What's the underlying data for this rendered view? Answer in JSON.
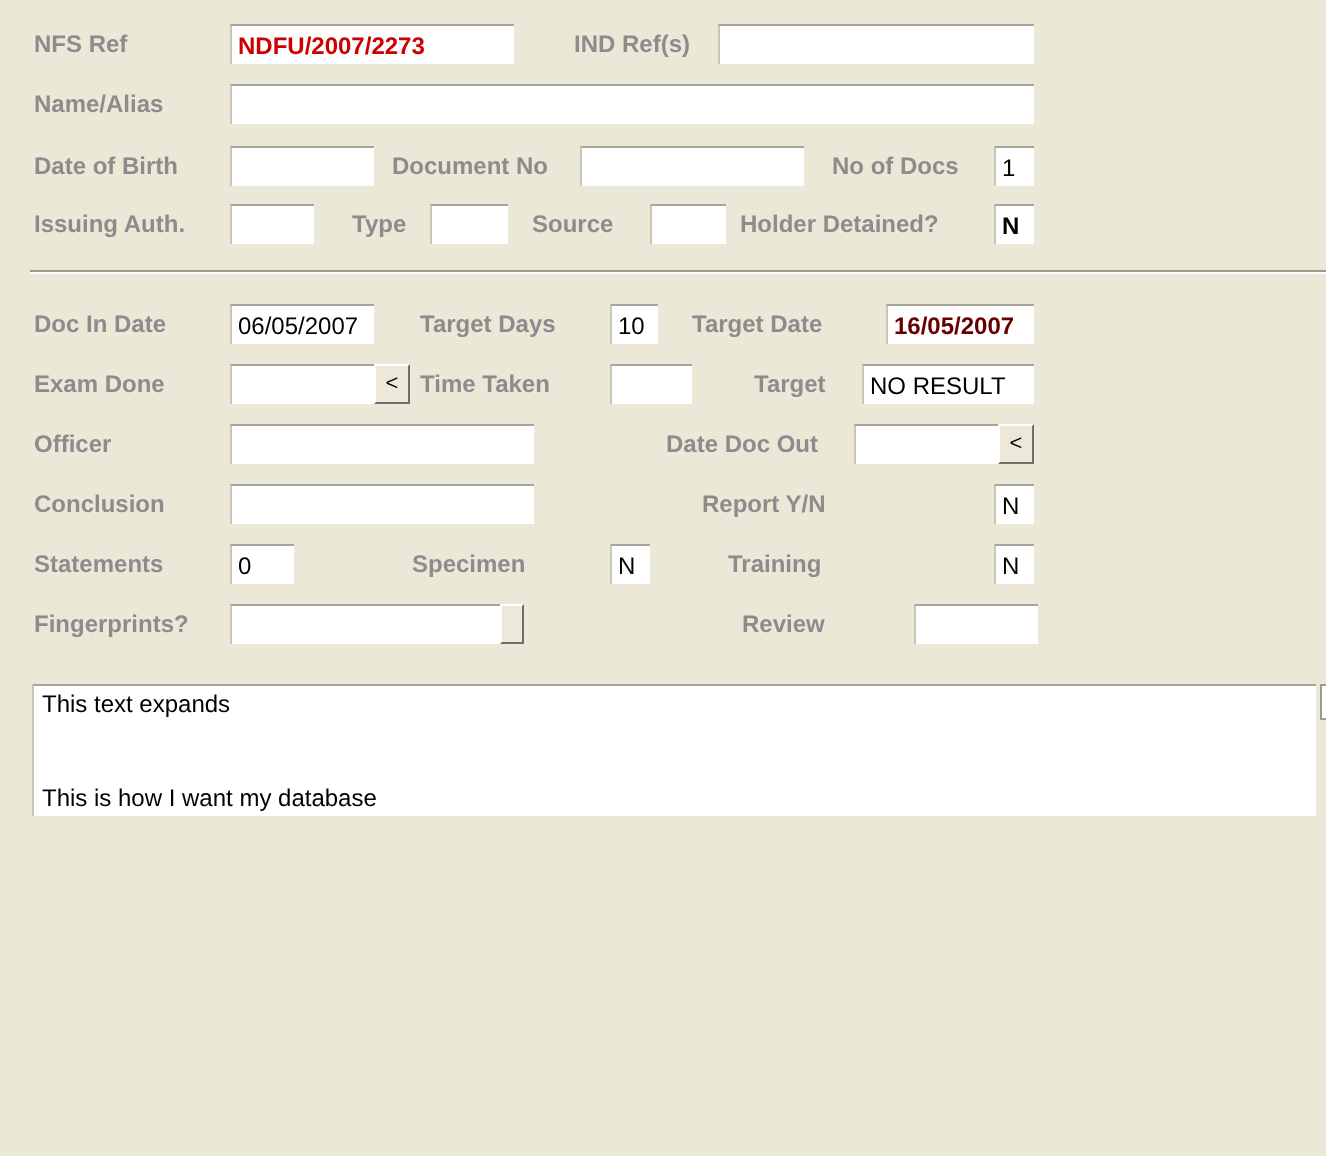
{
  "rows": [
    {
      "items": [
        {
          "kind": "label",
          "text": "NFS Ref"
        },
        {
          "kind": "field",
          "value": "NDFU/2007/2273",
          "bold": true,
          "color": "#cc0000"
        },
        {
          "kind": "label",
          "text": "IND Ref(s)"
        },
        {
          "kind": "field"
        }
      ]
    },
    {
      "items": [
        {
          "kind": "label",
          "text": "Name/Alias"
        },
        {
          "kind": "field"
        }
      ]
    },
    {
      "items": [
        {
          "kind": "label",
          "text": "Date of Birth"
        },
        {
          "kind": "field"
        },
        {
          "kind": "label",
          "text": "Document No"
        },
        {
          "kind": "field"
        },
        {
          "kind": "label",
          "text": "No of  Docs"
        },
        {
          "kind": "field",
          "value": "1",
          "bold": false
        }
      ]
    },
    {
      "items": [
        {
          "kind": "label",
          "text": "Issuing Auth."
        },
        {
          "kind": "field"
        },
        {
          "kind": "label",
          "text": "Type"
        },
        {
          "kind": "field"
        },
        {
          "kind": "label",
          "text": "Source"
        },
        {
          "kind": "field"
        },
        {
          "kind": "label",
          "text": "Holder Detained?"
        },
        {
          "kind": "field",
          "value": "N",
          "bold": true
        }
      ]
    },
    {
      "kind": "divider"
    },
    {
      "items": [
        {
          "kind": "label",
          "text": "Doc In Date"
        },
        {
          "kind": "field",
          "value": "06/05/2007",
          "bold": false
        },
        {
          "kind": "label",
          "text": "Target Days"
        },
        {
          "kind": "field",
          "value": "10",
          "bold": false
        },
        {
          "kind": "label",
          "text": "Target Date"
        },
        {
          "kind": "field",
          "value": "16/05/2007",
          "bold": true,
          "color": "#660000"
        }
      ]
    },
    {
      "items": [
        {
          "kind": "label",
          "text": "Exam Done"
        },
        {
          "kind": "combo",
          "button": "<"
        },
        {
          "kind": "label",
          "text": "Time Taken"
        },
        {
          "kind": "field"
        },
        {
          "kind": "label",
          "text": "Target"
        },
        {
          "kind": "field",
          "value": "NO RESULT",
          "bold": false
        }
      ]
    },
    {
      "items": [
        {
          "kind": "label",
          "text": "Officer"
        },
        {
          "kind": "field"
        },
        {
          "kind": "label",
          "text": "Date Doc Out"
        },
        {
          "kind": "combo",
          "button": "<"
        }
      ]
    },
    {
      "items": [
        {
          "kind": "label",
          "text": "Conclusion"
        },
        {
          "kind": "field"
        },
        {
          "kind": "label",
          "text": "Report Y/N"
        },
        {
          "kind": "field",
          "value": "N",
          "bold": false
        }
      ]
    },
    {
      "items": [
        {
          "kind": "label",
          "text": "Statements"
        },
        {
          "kind": "field",
          "value": "0",
          "bold": false
        },
        {
          "kind": "label",
          "text": "Specimen"
        },
        {
          "kind": "field",
          "value": "N",
          "bold": false
        },
        {
          "kind": "label",
          "text": "Training"
        },
        {
          "kind": "field",
          "value": "N",
          "bold": false
        }
      ]
    },
    {
      "items": [
        {
          "kind": "label",
          "text": "Fingerprints?"
        },
        {
          "kind": "combo"
        },
        {
          "kind": "label",
          "text": "Review"
        },
        {
          "kind": "field"
        }
      ]
    }
  ],
  "memo": {
    "lines": [
      "This text expands",
      "This is how I want my database"
    ]
  }
}
